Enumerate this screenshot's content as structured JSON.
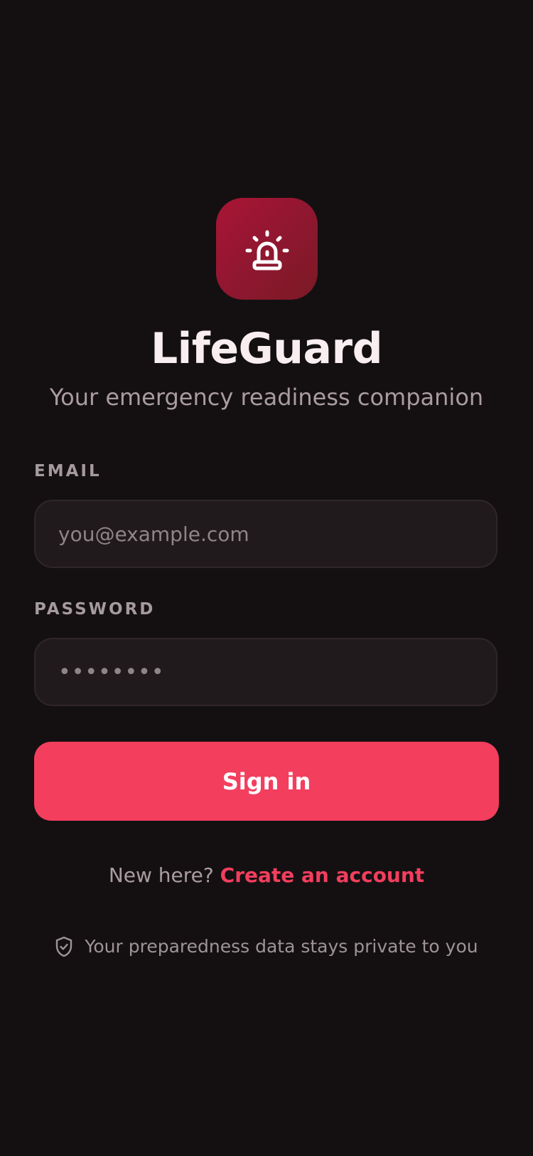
{
  "app": {
    "icon": "siren-icon",
    "name": "LifeGuard",
    "tagline": "Your emergency readiness companion"
  },
  "form": {
    "email_label": "EMAIL",
    "email_placeholder": "you@example.com",
    "email_value": "",
    "password_label": "PASSWORD",
    "password_value": "••••••••",
    "signin_label": "Sign in"
  },
  "signup": {
    "prompt": "New here?",
    "link": "Create an account"
  },
  "privacy": {
    "icon": "shield-check-icon",
    "text": "Your preparedness data stays private to you"
  },
  "colors": {
    "background": "#141012",
    "accent": "#f33e5e",
    "icon_gradient_start": "#a81535",
    "icon_gradient_end": "#7a1a24",
    "input_background": "#211a1c"
  }
}
